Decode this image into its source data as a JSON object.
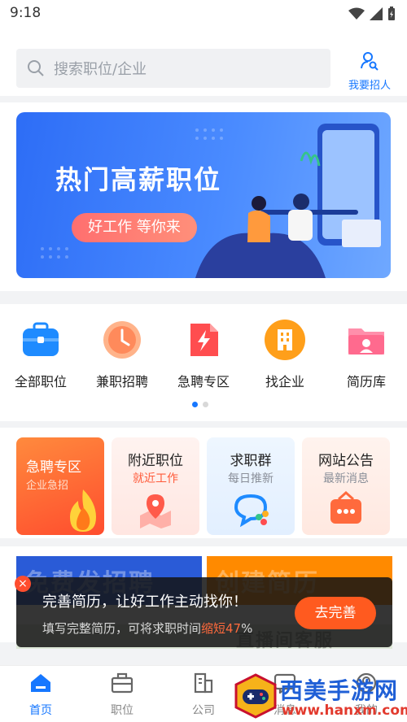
{
  "status_bar": {
    "time": "9:18"
  },
  "header": {
    "search_placeholder": "搜索职位/企业",
    "recruit_label": "我要招人"
  },
  "banner": {
    "title": "热门高薪职位",
    "pill": "好工作 等你来"
  },
  "categories": [
    {
      "label": "全部职位",
      "icon": "briefcase-icon",
      "color": "#1e8bff"
    },
    {
      "label": "兼职招聘",
      "icon": "clock-icon",
      "color": "#ff7a45"
    },
    {
      "label": "急聘专区",
      "icon": "lightning-icon",
      "color": "#ff4d4f"
    },
    {
      "label": "找企业",
      "icon": "building-icon",
      "color": "#ff9f1a"
    },
    {
      "label": "简历库",
      "icon": "folder-icon",
      "color": "#ff6a8e"
    }
  ],
  "pager": {
    "pages": 2,
    "active": 0
  },
  "feature_cards": [
    {
      "title": "急聘专区",
      "subtitle": "企业急招"
    },
    {
      "title": "附近职位",
      "subtitle": "就近工作"
    },
    {
      "title": "求职群",
      "subtitle": "每日推新"
    },
    {
      "title": "网站公告",
      "subtitle": "最新消息"
    }
  ],
  "promo": {
    "left": "免费发招聘",
    "right": "创建简历",
    "bottom": "直播间客服"
  },
  "toast": {
    "message": "完善简历，让好工作主动找你！",
    "sub_prefix": "填写完整简历，可将求职时间",
    "sub_highlight": "缩短47",
    "sub_suffix": "%",
    "button": "去完善",
    "close": "×"
  },
  "bottom_nav": [
    {
      "label": "首页",
      "icon": "home-icon",
      "active": true
    },
    {
      "label": "职位",
      "icon": "briefcase-icon",
      "active": false
    },
    {
      "label": "公司",
      "icon": "building-icon",
      "active": false
    },
    {
      "label": "消息",
      "icon": "message-icon",
      "active": false
    },
    {
      "label": "我的",
      "icon": "user-icon",
      "active": false
    }
  ],
  "watermark": {
    "name": "西美手游网",
    "url": "www.hanxm.com"
  },
  "colors": {
    "primary": "#1677ff",
    "accent": "#ff5a1f"
  }
}
